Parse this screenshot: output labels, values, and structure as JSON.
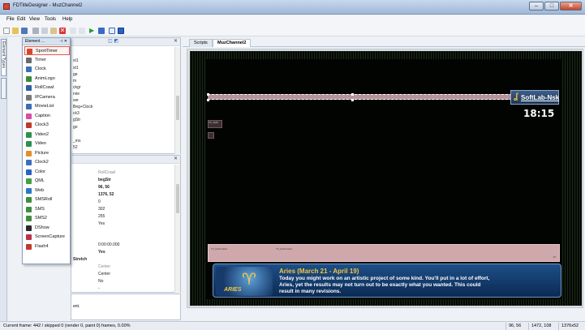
{
  "window": {
    "title": "FDTitleDesigner - MuzChannel2",
    "close_glyph": "✕",
    "min_glyph": "–",
    "max_glyph": "□"
  },
  "menu": [
    "File",
    "Edit",
    "View",
    "Tools",
    "Help"
  ],
  "toolbar_icons": [
    "new-icon",
    "open-icon",
    "save-icon",
    "cut-icon",
    "copy-icon",
    "paste-icon",
    "delete-icon",
    "undo-icon",
    "redo-icon",
    "play-icon",
    "stop-icon",
    "layout-icon",
    "grid-icon"
  ],
  "left_strip": {
    "tab_a": "Element Types",
    "tab_b": ""
  },
  "element_popup": {
    "title": "Element ...",
    "items": [
      {
        "label": "SportTimer",
        "icon": "sport-timer-icon",
        "color": "#d9452c"
      },
      {
        "label": "Timer",
        "icon": "timer-icon",
        "color": "#6a6a6a"
      },
      {
        "label": "Clock",
        "icon": "clock-icon",
        "color": "#3b6fb8"
      },
      {
        "label": "AnimLogo",
        "icon": "anim-logo-icon",
        "color": "#3a8a3a"
      },
      {
        "label": "RollCrawl",
        "icon": "roll-crawl-icon",
        "color": "#2f5fa0"
      },
      {
        "label": "IPCamera",
        "icon": "camera-icon",
        "color": "#777777"
      },
      {
        "label": "MovieList",
        "icon": "movie-list-icon",
        "color": "#3a6db5"
      },
      {
        "label": "Caption",
        "icon": "caption-icon",
        "color": "#d74fa0"
      },
      {
        "label": "Clock3",
        "icon": "clock3-icon",
        "color": "#c0392b"
      },
      {
        "label": "Video2",
        "icon": "video2-icon",
        "color": "#2d8f4e"
      },
      {
        "label": "Video",
        "icon": "video-icon",
        "color": "#2d8f4e"
      },
      {
        "label": "Picture",
        "icon": "picture-icon",
        "color": "#e0902a"
      },
      {
        "label": "Clock2",
        "icon": "clock2-icon",
        "color": "#3b6fb8"
      },
      {
        "label": "Color",
        "icon": "color-icon",
        "color": "#2a62c9"
      },
      {
        "label": "QML",
        "icon": "qml-icon",
        "color": "#41a33f"
      },
      {
        "label": "Web",
        "icon": "web-icon",
        "color": "#2a78c9"
      },
      {
        "label": "SMSRoll",
        "icon": "sms-roll-icon",
        "color": "#3e8e3e"
      },
      {
        "label": "SMS",
        "icon": "sms-icon",
        "color": "#3e8e3e"
      },
      {
        "label": "SMS2",
        "icon": "sms2-icon",
        "color": "#3e8e3e"
      },
      {
        "label": "DShow",
        "icon": "dshow-icon",
        "color": "#2a2a2a"
      },
      {
        "label": "ScreenCapture",
        "icon": "screen-capture-icon",
        "color": "#b8324a"
      },
      {
        "label": "Flash4",
        "icon": "flash-icon",
        "color": "#c0392b"
      }
    ]
  },
  "project_panel": {
    "title": "",
    "close": "✕",
    "items": [
      "xt1",
      "xt1",
      "ge",
      "m",
      "ckgr",
      "rvie",
      "ver",
      "Beg+Clock",
      "ck3",
      "gStr",
      "go",
      "_ms",
      "52"
    ]
  },
  "props_panel": {
    "close": "✕",
    "values": [
      "RollCrawl",
      "begStr",
      "96, 56",
      "1376, 52",
      "0",
      "302",
      "255",
      "Yes",
      "",
      "0:00:00.000",
      "Yes",
      "Stretch",
      "Center",
      "Center",
      "No",
      "",
      "-"
    ]
  },
  "help_panel": {
    "text": "ent."
  },
  "doc": {
    "tabs": [
      "Scripts",
      "MuzChannel2"
    ],
    "logo": "SoftLab-Nsk",
    "logo_glyph": "ʆ",
    "clock": "18:15",
    "crawl_label_a": "TK_RollCrawl1",
    "crawl_label_b": "TK_RollCrawl2",
    "crawl_counter": "25",
    "small_box_a": "TK_SMS",
    "horoscope": {
      "sign": "♈",
      "sign_label": "ARIES",
      "title": "Aries (March 21 - April 19)",
      "lines": [
        "Today you might work on an artistic project of some kind. You'll put in a lot of effort,",
        "Aries, yet the results may not turn out to be exactly what you wanted. This could",
        "result in many revisions."
      ]
    }
  },
  "status": {
    "main": "Current frame: 442 / skipped 0 (render 0, paint 0) frames, 0.00%",
    "cells": [
      "96, 56",
      "1472, 108",
      "1376x52"
    ]
  }
}
